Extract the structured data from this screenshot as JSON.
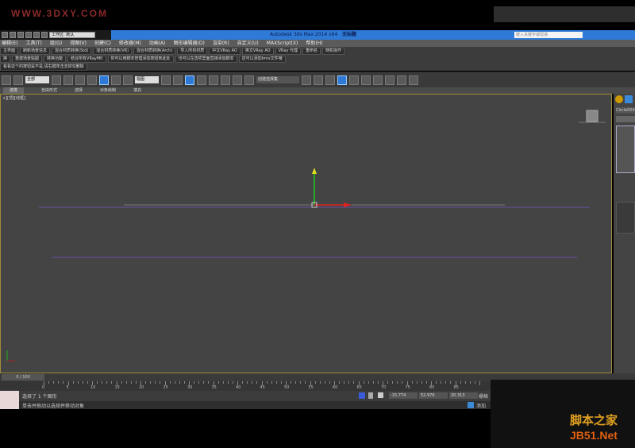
{
  "watermark": "WWW.3DXY.COM",
  "title": {
    "app": "Autodesk 3ds Max 2014 x64",
    "file": "无标题",
    "workspace": "工作区: 默认",
    "search_placeholder": "键入关键字或短语"
  },
  "menu": [
    "编辑(E)",
    "工具(T)",
    "组(G)",
    "视图(V)",
    "创建(C)",
    "修改器(M)",
    "动画(A)",
    "图形编辑器(D)",
    "渲染(R)",
    "自定义(U)",
    "MAXScript(X)",
    "帮助(H)"
  ],
  "custom_row1": [
    "主界面",
    "刷新场景信息",
    "混合材质转换(Std)",
    "混合材质转换(VR)",
    "混合材质转换(Arch)",
    "导入所有材质",
    "中文VRay AO",
    "英文VRay AO",
    "VRay 代理",
    "重命名",
    "随机操作"
  ],
  "custom_row2": [
    "换",
    "重建场景贴图",
    "转换功能",
    "结合所有VRayMtl",
    "你可以用脚本管理添加按钮到此处",
    "也可以在选项里面直接添加脚本",
    "还可以添加bmx文件哦"
  ],
  "custom_row3": [
    "看看这个的按钮是不是,请右键单击去掉勾删除"
  ],
  "toolbar": {
    "filter": "全部",
    "coord_system": "视图",
    "selection_set": "创建选择集"
  },
  "ribbon_tabs": [
    "建模",
    "自由形式",
    "选择",
    "对象绘制",
    "填充"
  ],
  "viewport_label": "+][顶][线框]",
  "command_panel": {
    "object_name": "Circle004"
  },
  "timeline": {
    "slider": "0 / 100",
    "ticks": [
      "0",
      "5",
      "10",
      "15",
      "20",
      "25",
      "30",
      "35",
      "40",
      "45",
      "50",
      "55",
      "60",
      "65",
      "70",
      "75",
      "80",
      "85"
    ]
  },
  "status": {
    "selection": "选择了 1 个图形",
    "prompt": "单击并拖动以选择并移动对象",
    "x": "-15.774",
    "y": "52.976",
    "z": "20.313",
    "grid": "栅格",
    "add_tag": "添加"
  },
  "logo": {
    "line1": "脚本之家",
    "line2": "JB51.Net"
  }
}
